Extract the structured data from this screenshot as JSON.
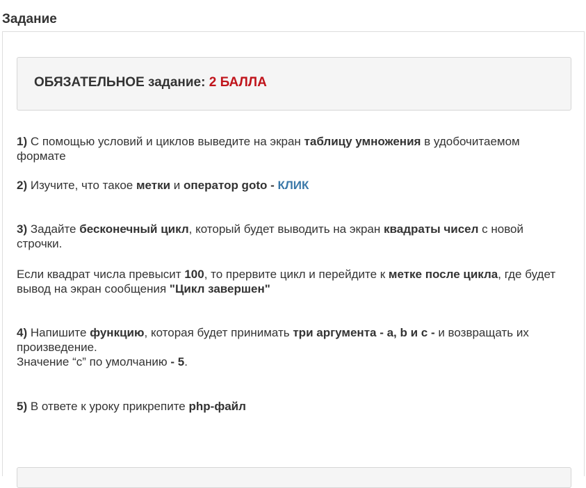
{
  "section": {
    "title": "Задание"
  },
  "alert": {
    "label": "ОБЯЗАТЕЛЬНОЕ задание:",
    "points": "2 БАЛЛА"
  },
  "tasks": {
    "t1": {
      "num": "1)",
      "a": " С помощью условий и циклов выведите на экран ",
      "b": "таблицу умножения",
      "c": " в удобочитаемом формате"
    },
    "t2": {
      "num": "2)",
      "a": " Изучите, что такое ",
      "b": "метки",
      "c": " и ",
      "d": "оператор goto - ",
      "link": "КЛИК"
    },
    "t3": {
      "num": "3)",
      "a": " Задайте ",
      "b": "бесконечный цикл",
      "c": ", который будет выводить на экран ",
      "d": "квадраты чисел",
      "e": " с новой строчки."
    },
    "t3b": {
      "a": "Если квадрат числа превысит ",
      "b": "100",
      "c": ", то прервите цикл и перейдите к ",
      "d": "метке после цикла",
      "e": ", где будет вывод на экран сообщения ",
      "f": "\"Цикл завершен\""
    },
    "t4": {
      "num": "4)",
      "a": " Напишите ",
      "b": "функцию",
      "c": ", которая будет принимать ",
      "d": "три аргумента - a, b и c -",
      "e": " и возвращать их произведение.",
      "f": "Значение “c” по умолчанию ",
      "g": "- 5",
      "h": "."
    },
    "t5": {
      "num": "5)",
      "a": " В ответе к уроку прикрепите ",
      "b": "php-файл"
    }
  }
}
